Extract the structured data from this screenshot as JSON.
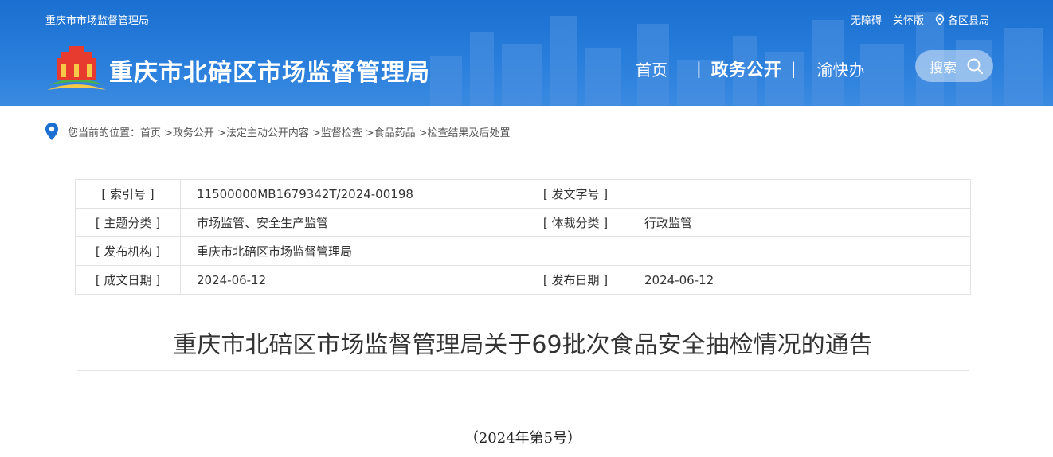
{
  "header": {
    "top_left": "重庆市市场监督管理局",
    "top_links": [
      "无障碍",
      "关怀版",
      "各区县局"
    ],
    "site_title": "重庆市北碚区市场监督管理局",
    "nav": [
      "首页",
      "政务公开",
      "渝快办"
    ],
    "nav_sep": "|",
    "search_label": "搜索",
    "colors": {
      "header_bg": "#1a6fd0",
      "text": "#ffffff"
    }
  },
  "breadcrumb": {
    "prefix": "您当前的位置：",
    "items": [
      "首页",
      ">政务公开",
      ">法定主动公开内容",
      ">监督检查",
      ">食品药品",
      ">检查结果及后处置"
    ]
  },
  "meta": {
    "rows": [
      {
        "k1": "[ 索引号 ]",
        "v1": "11500000MB1679342T/2024-00198",
        "k2": "[ 发文字号 ]",
        "v2": ""
      },
      {
        "k1": "[ 主题分类 ]",
        "v1": "市场监管、安全生产监管",
        "k2": "[ 体裁分类 ]",
        "v2": "行政监管"
      },
      {
        "k1": "[ 发布机构 ]",
        "v1": "重庆市北碚区市场监督管理局",
        "k2": "",
        "v2": ""
      },
      {
        "k1": "[ 成文日期 ]",
        "v1": "2024-06-12",
        "k2": "[ 发布日期 ]",
        "v2": "2024-06-12"
      }
    ]
  },
  "document": {
    "title": "重庆市北碚区市场监督管理局关于69批次食品安全抽检情况的通告",
    "number": "（2024年第5号）"
  }
}
